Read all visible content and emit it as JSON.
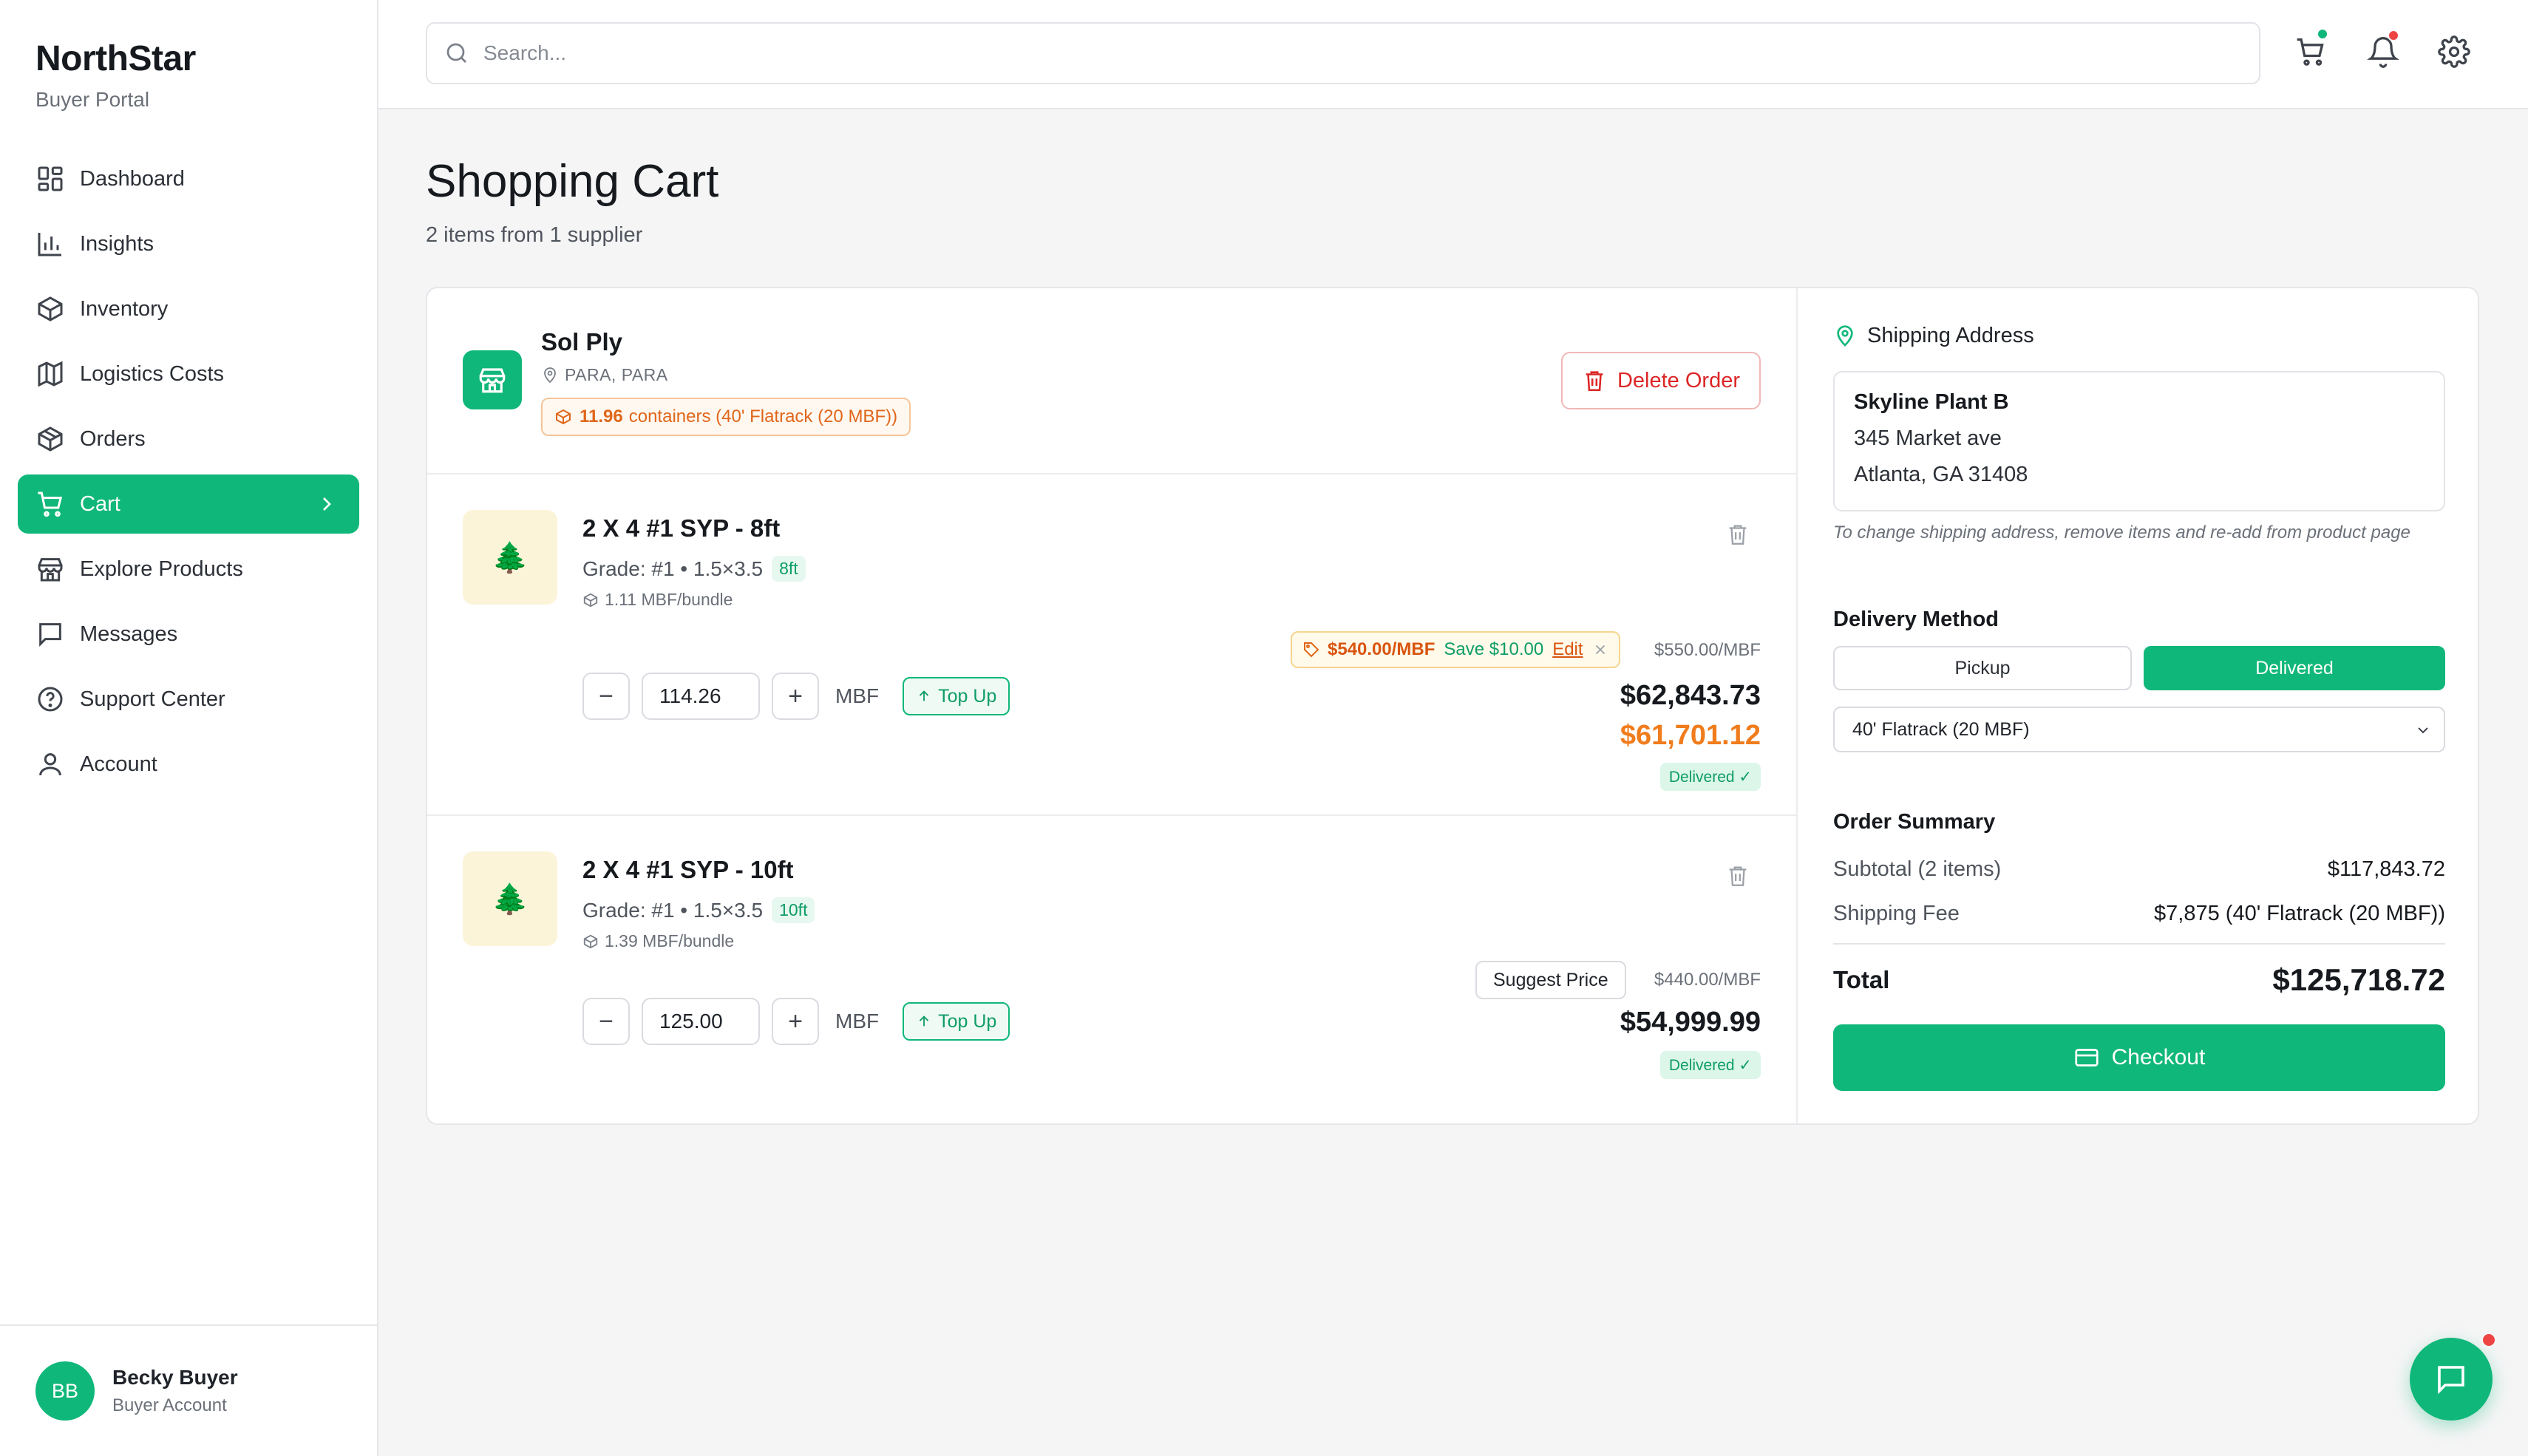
{
  "brand": {
    "name": "NorthStar",
    "subtitle": "Buyer Portal"
  },
  "nav": {
    "items": [
      {
        "label": "Dashboard",
        "icon": "dashboard-icon"
      },
      {
        "label": "Insights",
        "icon": "bar-chart-icon"
      },
      {
        "label": "Inventory",
        "icon": "box-icon"
      },
      {
        "label": "Logistics Costs",
        "icon": "map-icon"
      },
      {
        "label": "Orders",
        "icon": "package-icon"
      },
      {
        "label": "Cart",
        "icon": "cart-icon",
        "active": true
      },
      {
        "label": "Explore Products",
        "icon": "store-icon"
      },
      {
        "label": "Messages",
        "icon": "message-icon"
      },
      {
        "label": "Support Center",
        "icon": "help-circle-icon"
      },
      {
        "label": "Account",
        "icon": "user-icon"
      }
    ]
  },
  "user": {
    "initials": "BB",
    "name": "Becky Buyer",
    "role": "Buyer Account"
  },
  "search": {
    "placeholder": "Search..."
  },
  "colors": {
    "accent": "#10b77a",
    "danger": "#dc2626",
    "offer": "#f07c1c",
    "notification": "#ef4444"
  },
  "page": {
    "title": "Shopping Cart",
    "subtitle": "2 items from 1 supplier"
  },
  "supplier": {
    "name": "Sol Ply",
    "location": "PARA, PARA",
    "containers_count": "11.96",
    "containers_text": "containers (40' Flatrack (20 MBF))",
    "delete_label": "Delete Order"
  },
  "items": [
    {
      "title": "2 X 4 #1 SYP - 8ft",
      "grade": "Grade: #1 • 1.5×3.5",
      "length_tag": "8ft",
      "bundle": "1.11 MBF/bundle",
      "quantity": "114.26",
      "unit": "MBF",
      "topup_label": "Top Up",
      "offer_price": "$540.00/MBF",
      "offer_save": "Save $10.00",
      "offer_edit": "Edit",
      "list_price": "$550.00/MBF",
      "total": "$62,843.73",
      "offer_total": "$61,701.12",
      "status": "Delivered ✓"
    },
    {
      "title": "2 X 4 #1 SYP - 10ft",
      "grade": "Grade: #1 • 1.5×3.5",
      "length_tag": "10ft",
      "bundle": "1.39 MBF/bundle",
      "quantity": "125.00",
      "unit": "MBF",
      "topup_label": "Top Up",
      "suggest_label": "Suggest Price",
      "list_price": "$440.00/MBF",
      "total": "$54,999.99",
      "status": "Delivered ✓"
    }
  ],
  "shipping": {
    "title": "Shipping Address",
    "name": "Skyline Plant B",
    "line1": "345 Market ave",
    "line2": "Atlanta, GA 31408",
    "note": "To change shipping address, remove items and re-add from product page"
  },
  "delivery": {
    "title": "Delivery Method",
    "pickup_label": "Pickup",
    "delivered_label": "Delivered",
    "selected_option": "40' Flatrack (20 MBF)"
  },
  "summary": {
    "title": "Order Summary",
    "subtotal_label": "Subtotal (2 items)",
    "subtotal_value": "$117,843.72",
    "shipping_label": "Shipping Fee",
    "shipping_value": "$7,875 (40' Flatrack (20 MBF))",
    "total_label": "Total",
    "total_value": "$125,718.72",
    "checkout_label": "Checkout"
  }
}
